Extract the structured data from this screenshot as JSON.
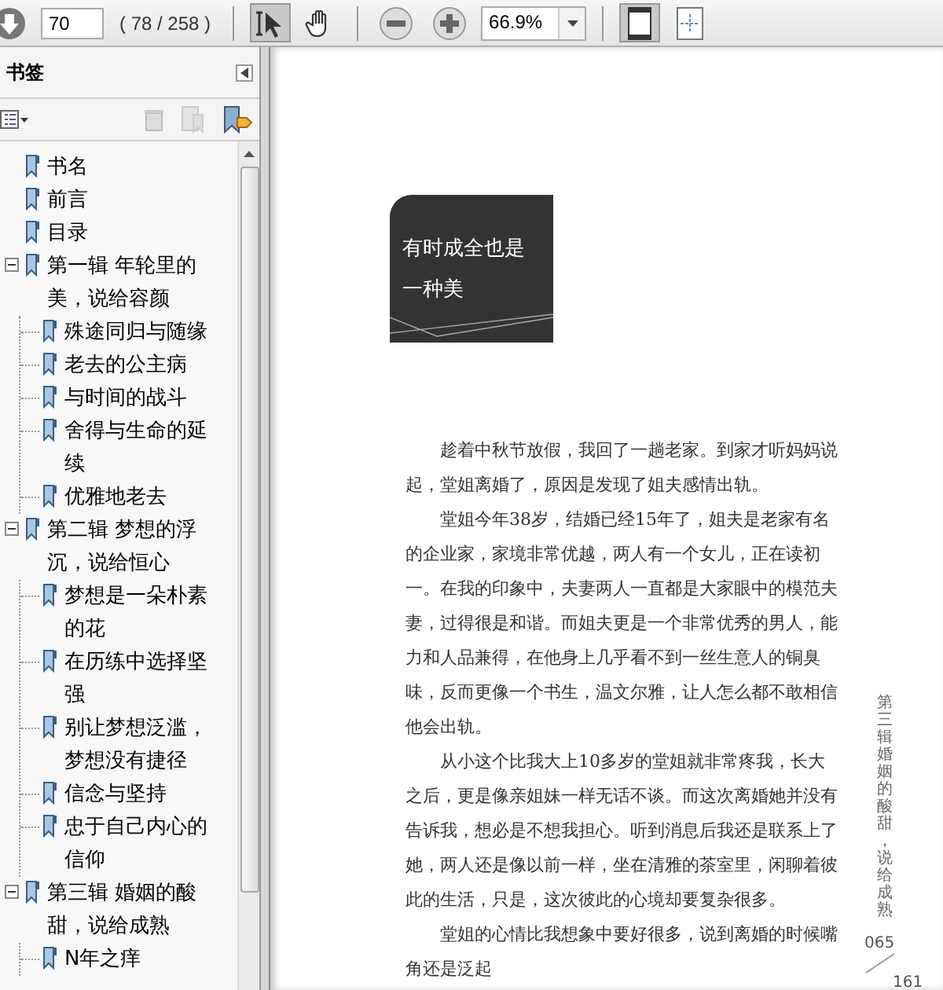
{
  "toolbar": {
    "page_field": "70",
    "page_count": "( 78 / 258 )",
    "tools": [
      {
        "kind": "select",
        "selected": true
      },
      {
        "kind": "hand",
        "selected": false
      }
    ],
    "zoom_field": "66.9%",
    "views": [
      {
        "kind": "fit-page",
        "selected": true
      },
      {
        "kind": "fit-full",
        "selected": false
      }
    ]
  },
  "bookmarks": {
    "title": "书签",
    "items": [
      {
        "label": "书名"
      },
      {
        "label": "前言"
      },
      {
        "label": "目录"
      },
      {
        "label": "第一辑  年轮里的美，说给容颜",
        "expanded": true,
        "children": [
          {
            "label": "殊途同归与随缘"
          },
          {
            "label": "老去的公主病"
          },
          {
            "label": "与时间的战斗"
          },
          {
            "label": "舍得与生命的延续"
          },
          {
            "label": "优雅地老去"
          }
        ]
      },
      {
        "label": "第二辑  梦想的浮沉，说给恒心",
        "expanded": true,
        "children": [
          {
            "label": "梦想是一朵朴素的花"
          },
          {
            "label": "在历练中选择坚强"
          },
          {
            "label": "别让梦想泛滥，梦想没有捷径"
          },
          {
            "label": "信念与坚持"
          },
          {
            "label": "忠于自己内心的信仰"
          }
        ]
      },
      {
        "label": "第三辑  婚姻的酸甜，说给成熟",
        "expanded": true,
        "children": [
          {
            "label": "N年之痒"
          }
        ]
      }
    ]
  },
  "document": {
    "chapter_title": "有时成全也是一种美",
    "paragraphs": [
      "趁着中秋节放假，我回了一趟老家。到家才听妈妈说起，堂姐离婚了，原因是发现了姐夫感情出轨。",
      "堂姐今年38岁，结婚已经15年了，姐夫是老家有名的企业家，家境非常优越，两人有一个女儿，正在读初一。在我的印象中，夫妻两人一直都是大家眼中的模范夫妻，过得很是和谐。而姐夫更是一个非常优秀的男人，能力和人品兼得，在他身上几乎看不到一丝生意人的铜臭味，反而更像一个书生，温文尔雅，让人怎么都不敢相信他会出轨。",
      "从小这个比我大上10多岁的堂姐就非常疼我，长大之后，更是像亲姐妹一样无话不谈。而这次离婚她并没有告诉我，想必是不想我担心。听到消息后我还是联系上了她，两人还是像以前一样，坐在清雅的茶室里，闲聊着彼此的生活，只是，这次彼此的心境却要复杂很多。",
      "堂姐的心情比我想象中要好很多，说到离婚的时候嘴角还是泛起"
    ],
    "running_head": "第三辑婚姻的酸甜，说给成熟",
    "page_numbers": [
      "065",
      "161"
    ]
  }
}
